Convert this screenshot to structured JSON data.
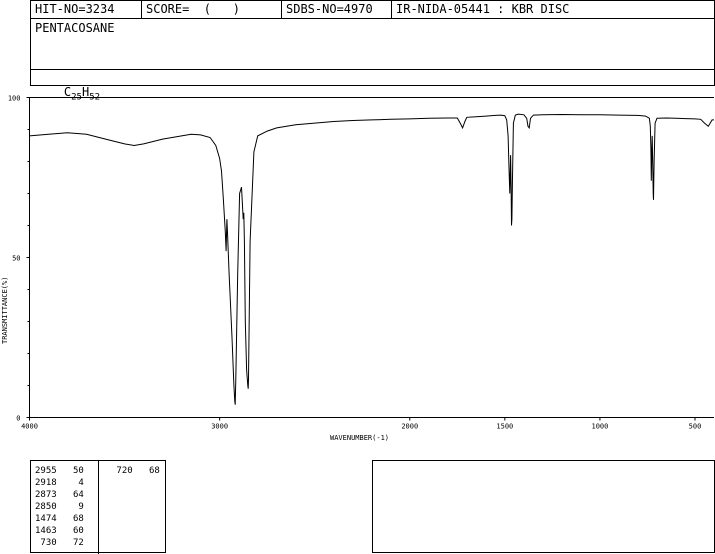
{
  "header": {
    "hit_no": "HIT-NO=3234",
    "score": "SCORE=  (   )",
    "sdbs_no": "SDBS-NO=4970",
    "method": "IR-NIDA-05441 : KBR DISC",
    "compound_name": "PENTACOSANE",
    "formula_base": "C",
    "formula_c_count": "25",
    "formula_h": "H",
    "formula_h_count": "52"
  },
  "chart_data": {
    "type": "line",
    "title": "",
    "xlabel": "WAVENUMBER(-1)",
    "ylabel": "TRANSMITTANCE(%)",
    "xlim": [
      4000,
      400
    ],
    "ylim": [
      0,
      100
    ],
    "x_reversed": true,
    "x_ticks": [
      {
        "value": 4000,
        "label": "4000"
      },
      {
        "value": 3000,
        "label": "3000"
      },
      {
        "value": 2000,
        "label": "2000"
      },
      {
        "value": 1500,
        "label": "1500"
      },
      {
        "value": 1000,
        "label": "1000"
      },
      {
        "value": 500,
        "label": "500"
      }
    ],
    "y_ticks": [
      {
        "value": 100,
        "label": "100"
      },
      {
        "value": 50,
        "label": "50"
      },
      {
        "value": 0,
        "label": "0"
      }
    ],
    "grid": false,
    "series": [
      {
        "x": [
          4000,
          3900,
          3800,
          3700,
          3600,
          3500,
          3450,
          3400,
          3300,
          3200,
          3150,
          3100,
          3050,
          3020,
          3000,
          2990,
          2980,
          2970,
          2966,
          2962,
          2958,
          2950,
          2935,
          2925,
          2920,
          2918,
          2915,
          2905,
          2895,
          2885,
          2876,
          2873,
          2870,
          2865,
          2858,
          2852,
          2850,
          2848,
          2840,
          2820,
          2800,
          2750,
          2700,
          2600,
          2500,
          2400,
          2300,
          2200,
          2100,
          2000,
          1900,
          1800,
          1750,
          1735,
          1722,
          1710,
          1700,
          1650,
          1600,
          1550,
          1520,
          1500,
          1490,
          1483,
          1478,
          1474,
          1470,
          1467,
          1465,
          1463,
          1460,
          1455,
          1445,
          1430,
          1400,
          1385,
          1378,
          1372,
          1365,
          1350,
          1300,
          1200,
          1100,
          1000,
          900,
          800,
          760,
          740,
          735,
          732,
          730,
          728,
          725,
          722,
          720,
          718,
          715,
          710,
          700,
          650,
          600,
          550,
          500,
          470,
          450,
          430,
          420,
          410,
          400
        ],
        "y": [
          88,
          88.5,
          89,
          88.5,
          87,
          85.5,
          85,
          85.5,
          87,
          88,
          88.5,
          88.3,
          87.5,
          85,
          81,
          77,
          68,
          58,
          52,
          62,
          57,
          45,
          25,
          10,
          5,
          4,
          12,
          45,
          70,
          72,
          62,
          64,
          55,
          30,
          15,
          10,
          9,
          12,
          55,
          83,
          88,
          89.5,
          90.5,
          91.5,
          92,
          92.5,
          92.8,
          93,
          93.2,
          93.3,
          93.5,
          93.6,
          93.6,
          92,
          90.5,
          92.5,
          93.8,
          94,
          94.2,
          94.4,
          94.5,
          94.3,
          93,
          88,
          78,
          70,
          82,
          72,
          60,
          62,
          75,
          92,
          94.5,
          94.8,
          94.6,
          93.5,
          91,
          90.5,
          93.5,
          94.5,
          94.6,
          94.7,
          94.6,
          94.6,
          94.5,
          94.4,
          94.2,
          93.5,
          91,
          84,
          74,
          80,
          88,
          78,
          70,
          68,
          80,
          92,
          93.5,
          93.6,
          93.5,
          93.4,
          93.3,
          93.2,
          92,
          91,
          92,
          93,
          93
        ]
      }
    ],
    "peaks": [
      {
        "wavenumber": 2955,
        "intensity": 50
      },
      {
        "wavenumber": 2918,
        "intensity": 4
      },
      {
        "wavenumber": 2873,
        "intensity": 64
      },
      {
        "wavenumber": 2850,
        "intensity": 9
      },
      {
        "wavenumber": 1474,
        "intensity": 68
      },
      {
        "wavenumber": 1463,
        "intensity": 60
      },
      {
        "wavenumber": 730,
        "intensity": 72
      },
      {
        "wavenumber": 720,
        "intensity": 68
      }
    ]
  }
}
